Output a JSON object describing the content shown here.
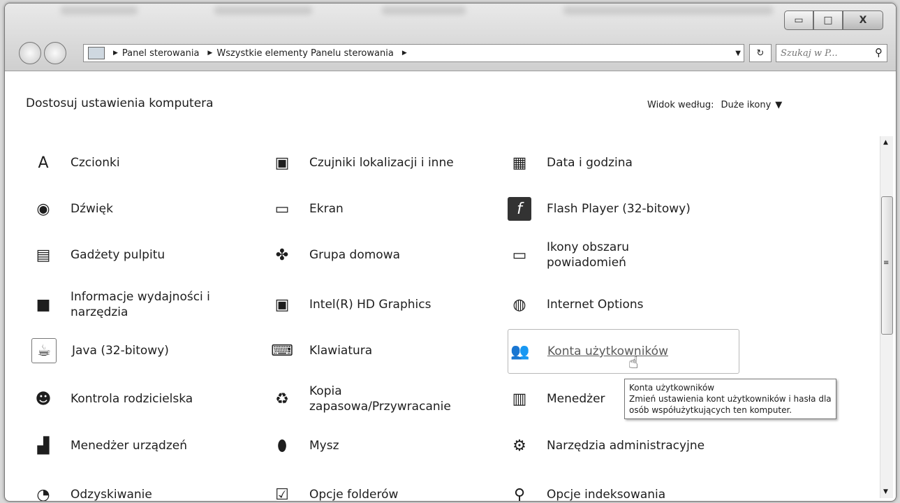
{
  "window": {
    "caption_buttons": {
      "minimize": "▭",
      "maximize": "□",
      "close": "X"
    },
    "address_bar": {
      "crumbs": [
        "Panel sterowania",
        "Wszystkie elementy Panelu sterowania"
      ],
      "refresh_icon": "refresh-icon"
    },
    "search": {
      "placeholder": "Szukaj w P..."
    }
  },
  "header": {
    "title": "Dostosuj ustawienia komputera",
    "view_label": "Widok według:",
    "view_value": "Duże ikony"
  },
  "items": [
    {
      "label": "Czcionki",
      "icon": "font-icon"
    },
    {
      "label": "Czujniki lokalizacji i inne",
      "icon": "sensor-icon"
    },
    {
      "label": "Data i godzina",
      "icon": "calendar-clock-icon"
    },
    {
      "label": "Dźwięk",
      "icon": "speaker-icon"
    },
    {
      "label": "Ekran",
      "icon": "monitor-icon"
    },
    {
      "label": "Flash Player (32-bitowy)",
      "icon": "flash-icon"
    },
    {
      "label": "Gadżety pulpitu",
      "icon": "gadgets-icon"
    },
    {
      "label": "Grupa domowa",
      "icon": "homegroup-icon"
    },
    {
      "label": "Ikony obszaru powiadomień",
      "icon": "notification-icons-icon"
    },
    {
      "label": "Informacje wydajności i narzędzia",
      "icon": "performance-icon"
    },
    {
      "label": "Intel(R) HD Graphics",
      "icon": "intel-graphics-icon"
    },
    {
      "label": "Internet Options",
      "icon": "internet-options-icon"
    },
    {
      "label": "Java (32-bitowy)",
      "icon": "java-icon"
    },
    {
      "label": "Klawiatura",
      "icon": "keyboard-icon"
    },
    {
      "label": "Konta użytkowników",
      "icon": "user-accounts-icon"
    },
    {
      "label": "Kontrola rodzicielska",
      "icon": "parental-controls-icon"
    },
    {
      "label": "Kopia zapasowa/Przywracanie",
      "icon": "backup-icon"
    },
    {
      "label": "Menedżer",
      "icon": "credential-manager-icon"
    },
    {
      "label": "Menedżer urządzeń",
      "icon": "device-manager-icon"
    },
    {
      "label": "Mysz",
      "icon": "mouse-icon"
    },
    {
      "label": "Narzędzia administracyjne",
      "icon": "admin-tools-icon"
    },
    {
      "label": "Odzyskiwanie",
      "icon": "recovery-icon"
    },
    {
      "label": "Opcje folderów",
      "icon": "folder-options-icon"
    },
    {
      "label": "Opcje indeksowania",
      "icon": "indexing-icon"
    }
  ],
  "tooltip": {
    "title": "Konta użytkowników",
    "text": "Zmień ustawienia kont użytkowników i hasła dla osób współużytkujących ten komputer."
  }
}
